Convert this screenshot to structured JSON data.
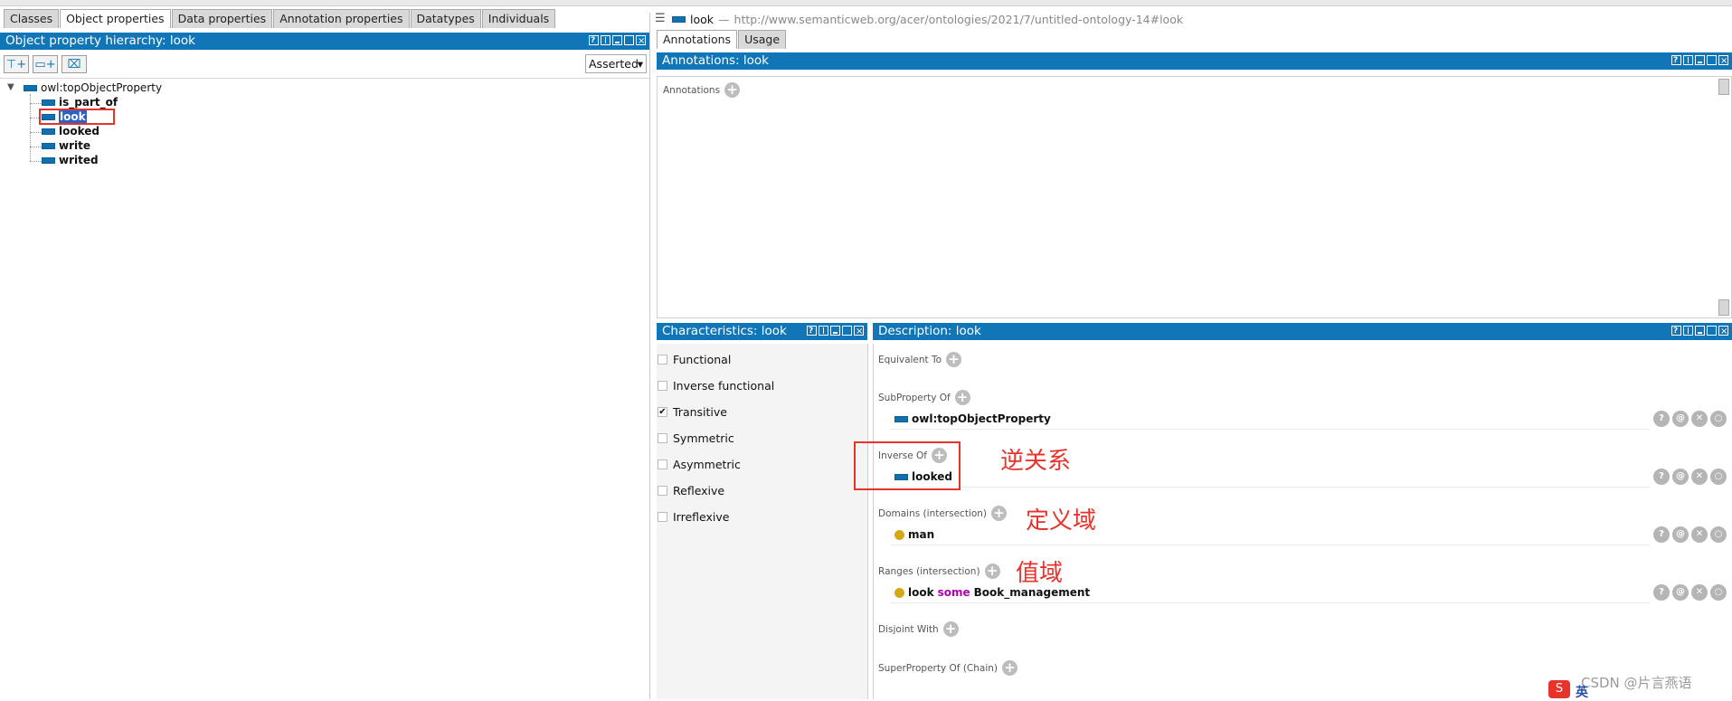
{
  "tabs": [
    "Classes",
    "Object properties",
    "Data properties",
    "Annotation properties",
    "Datatypes",
    "Individuals"
  ],
  "active_tab_index": 1,
  "hierarchy": {
    "title": "Object property hierarchy: look",
    "mode": "Asserted",
    "root": "owl:topObjectProperty",
    "children": [
      "is_part_of",
      "look",
      "looked",
      "write",
      "writed"
    ],
    "selected": "look"
  },
  "entity_header": {
    "name": "look",
    "separator": "—",
    "iri": "http://www.semanticweb.org/acer/ontologies/2021/7/untitled-ontology-14#look"
  },
  "right_tabs": [
    "Annotations",
    "Usage"
  ],
  "annotations_panel": {
    "title": "Annotations: look",
    "label": "Annotations"
  },
  "characteristics": {
    "title": "Characteristics: look",
    "items": [
      {
        "label": "Functional",
        "checked": false
      },
      {
        "label": "Inverse functional",
        "checked": false
      },
      {
        "label": "Transitive",
        "checked": true
      },
      {
        "label": "Symmetric",
        "checked": false
      },
      {
        "label": "Asymmetric",
        "checked": false
      },
      {
        "label": "Reflexive",
        "checked": false
      },
      {
        "label": "Irreflexive",
        "checked": false
      }
    ]
  },
  "description": {
    "title": "Description: look",
    "equivalent_to": "Equivalent To",
    "subproperty_of": "SubProperty Of",
    "subproperty_value": "owl:topObjectProperty",
    "inverse_of": "Inverse Of",
    "inverse_value": "looked",
    "domains": "Domains (intersection)",
    "domain_value": "man",
    "ranges": "Ranges (intersection)",
    "range_value": {
      "prop": "look",
      "keyword": "some",
      "cls": "Book_management"
    },
    "disjoint_with": "Disjoint With",
    "superproperty_chain": "SuperProperty Of (Chain)"
  },
  "annotations_overlay": {
    "inverse": "逆关系",
    "domain": "定义域",
    "range": "值域"
  },
  "watermark": "CSDN @片言燕语",
  "ime_label": "英",
  "colors": {
    "header_blue": "#1176b7",
    "annotation_red": "#e8332b",
    "keyword_purple": "#b000b0",
    "class_gold": "#d4a817"
  }
}
